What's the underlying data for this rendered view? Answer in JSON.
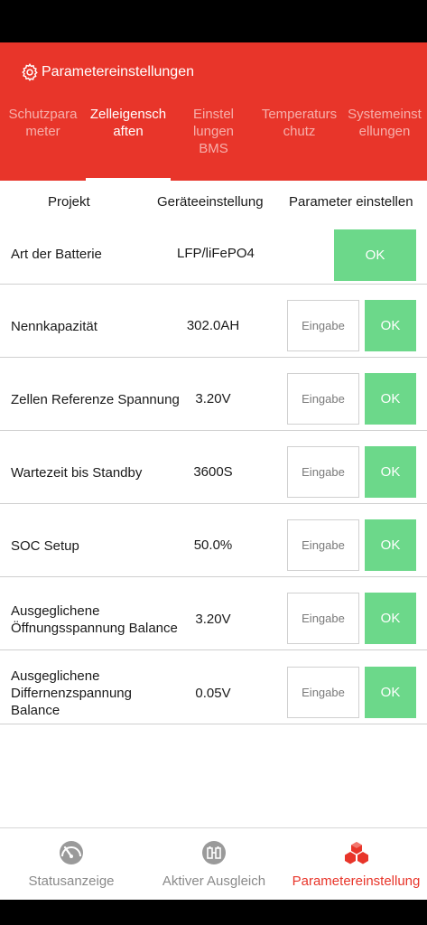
{
  "header": {
    "title": "Parametereinstellungen"
  },
  "tabs": [
    {
      "label": "Schutzpara\nmeter",
      "active": false
    },
    {
      "label": "Zelleigensch\naften",
      "active": true
    },
    {
      "label": "Einstel\nlungen\nBMS",
      "active": false
    },
    {
      "label": "Temperaturs\nchutz",
      "active": false
    },
    {
      "label": "Systemeinst\nellungen",
      "active": false
    }
  ],
  "columns": {
    "project": "Projekt",
    "device_setting": "Geräteeinstellung",
    "set_parameter": "Parameter einstellen"
  },
  "rows": [
    {
      "label": "Art der Batterie",
      "value": "LFP/liFePO4",
      "ok": "OK"
    },
    {
      "label": "Nennkapazität",
      "value": "302.0AH",
      "input_placeholder": "Eingabe",
      "ok": "OK"
    },
    {
      "label": "Zellen Referenze Spannung",
      "value": "3.20V",
      "input_placeholder": "Eingabe",
      "ok": "OK"
    },
    {
      "label": "Wartezeit bis Standby",
      "value": "3600S",
      "input_placeholder": "Eingabe",
      "ok": "OK"
    },
    {
      "label": "SOC Setup",
      "value": "50.0%",
      "input_placeholder": "Eingabe",
      "ok": "OK"
    },
    {
      "label": "Ausgeglichene\nÖffnungsspannung Balance",
      "value": "3.20V",
      "input_placeholder": "Eingabe",
      "ok": "OK"
    },
    {
      "label": "Ausgeglichene\nDiffernenzspannung\nBalance",
      "value": "0.05V",
      "input_placeholder": "Eingabe",
      "ok": "OK"
    }
  ],
  "bottom_nav": [
    {
      "label": "Statusanzeige",
      "icon": "status-gauge-icon",
      "active": false
    },
    {
      "label": "Aktiver Ausgleich",
      "icon": "balance-battery-icon",
      "active": false
    },
    {
      "label": "Parametereinstellung",
      "icon": "parameter-cubes-icon",
      "active": true
    }
  ],
  "colors": {
    "accent": "#e8352a",
    "ok_button": "#6cd88a",
    "inactive_text": "#8a8a8a"
  }
}
